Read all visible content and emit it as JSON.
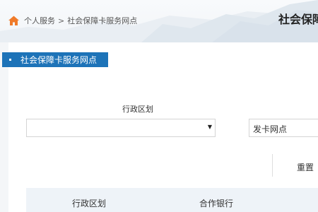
{
  "breadcrumb": {
    "items": [
      "个人服务",
      "社会保障卡服务网点"
    ],
    "separator": ">"
  },
  "header": {
    "title": "社会保障"
  },
  "section_tag": {
    "label": "社会保障卡服务网点"
  },
  "filters": {
    "region_label": "行政区划",
    "region_value": "",
    "outlet_value": "发卡网点"
  },
  "actions": {
    "reset_label": "重置"
  },
  "table": {
    "columns": [
      "行政区划",
      "合作银行"
    ]
  },
  "colors": {
    "accent": "#1d73b8",
    "home_icon": "#f07b2a",
    "table_header_bg": "#eef3f8"
  }
}
